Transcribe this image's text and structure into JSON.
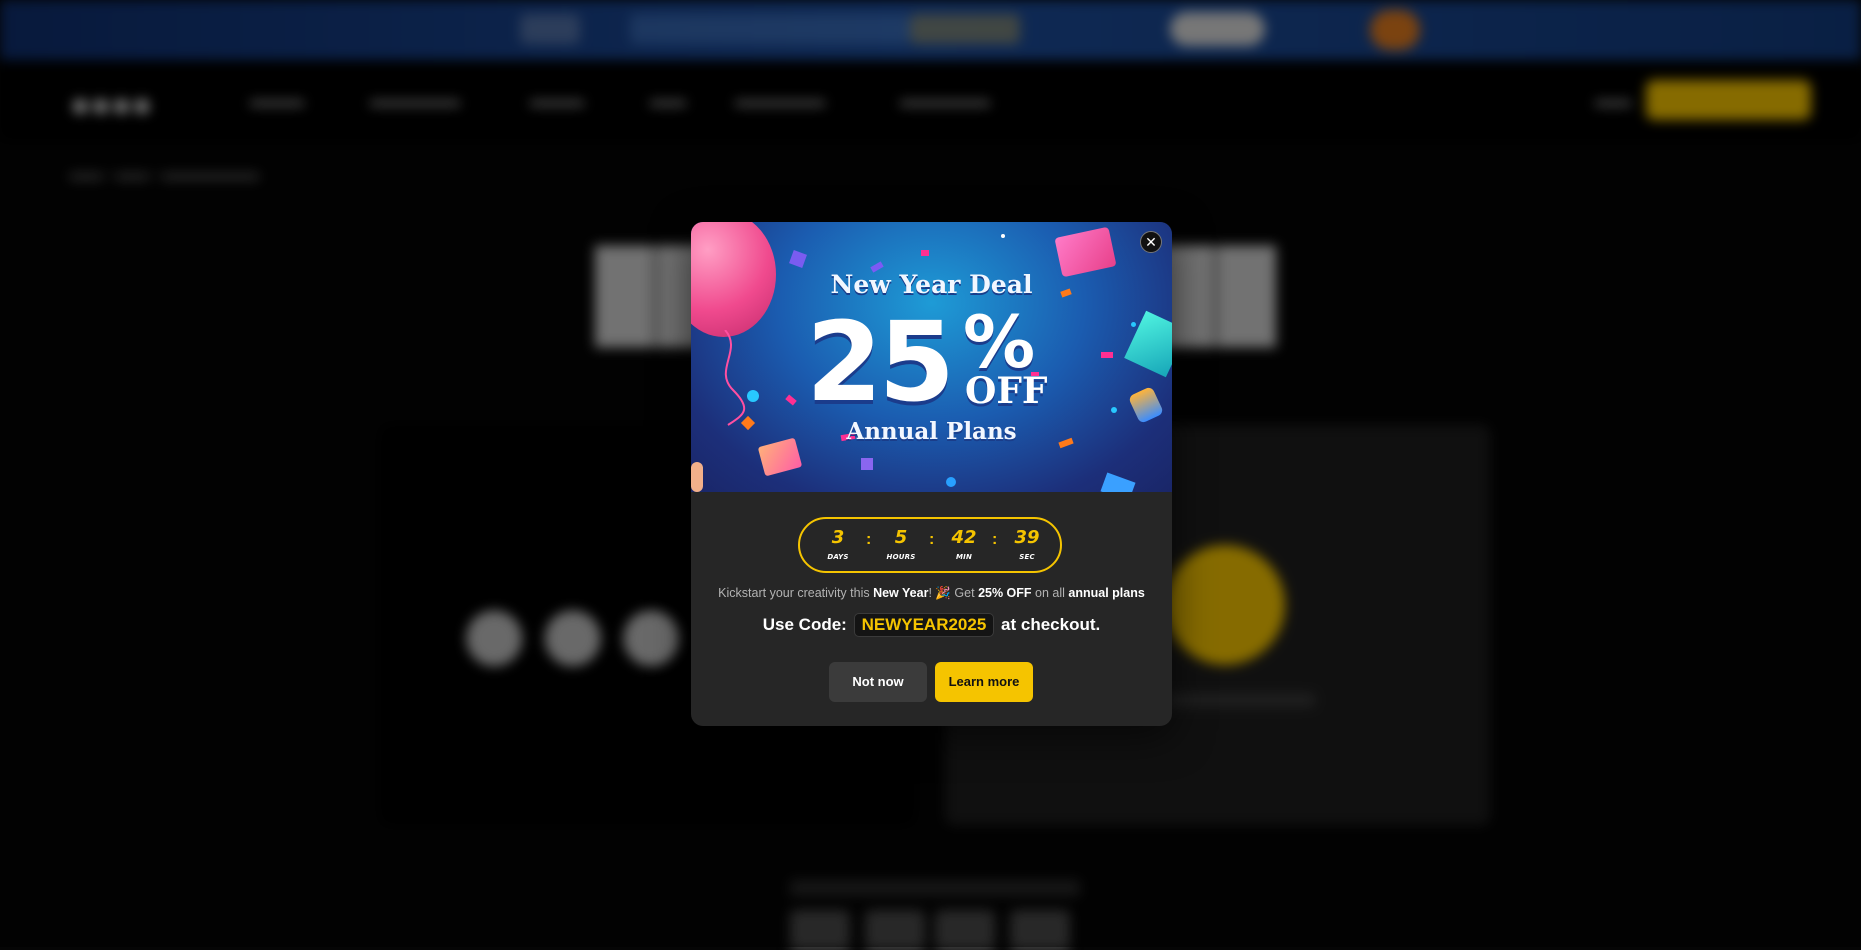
{
  "modal": {
    "close_glyph": "✕",
    "banner": {
      "title": "New Year Deal",
      "discount_number": "25",
      "discount_percent": "%",
      "discount_off": "OFF",
      "subtitle": "Annual Plans"
    },
    "countdown": {
      "days": "3",
      "days_label": "DAYS",
      "hours": "5",
      "hours_label": "HOURS",
      "min": "42",
      "min_label": "MIN",
      "sec": "39",
      "sec_label": "SEC",
      "separator": ":"
    },
    "promo": {
      "part1": "Kickstart your creativity this ",
      "new_year": "New Year",
      "part2": "! 🎉 Get ",
      "discount": "25% OFF",
      "part3": " on all ",
      "plans": "annual plans"
    },
    "code": {
      "prefix": "Use Code:",
      "value": "NEWYEAR2025",
      "suffix": "at checkout."
    },
    "buttons": {
      "not_now": "Not now",
      "learn_more": "Learn more"
    }
  },
  "colors": {
    "accent": "#f5c400",
    "modal_bg": "#262626",
    "secondary_button": "#3b3b3b"
  }
}
